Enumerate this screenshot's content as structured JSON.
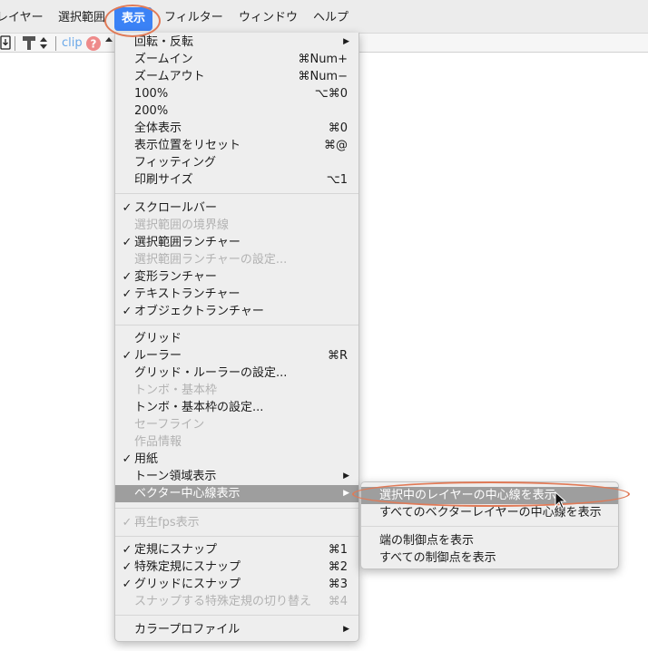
{
  "menubar": {
    "items": [
      "レイヤー",
      "選択範囲",
      "表示",
      "フィルター",
      "ウィンドウ",
      "ヘルプ"
    ]
  },
  "toolbar": {
    "clip_label": "clip",
    "help_symbol": "?"
  },
  "view_menu": {
    "items": [
      {
        "label": "回転・反転",
        "submenu": true
      },
      {
        "label": "ズームイン",
        "shortcut": "⌘Num+"
      },
      {
        "label": "ズームアウト",
        "shortcut": "⌘Num−"
      },
      {
        "label": "100%",
        "shortcut": "⌥⌘0"
      },
      {
        "label": "200%",
        "shortcut": ""
      },
      {
        "label": "全体表示",
        "shortcut": "⌘0"
      },
      {
        "label": "表示位置をリセット",
        "shortcut": "⌘@"
      },
      {
        "label": "フィッティング",
        "shortcut": ""
      },
      {
        "label": "印刷サイズ",
        "shortcut": "⌥1"
      },
      {
        "label": "スクロールバー",
        "checked": true
      },
      {
        "label": "選択範囲の境界線",
        "disabled": true
      },
      {
        "label": "選択範囲ランチャー",
        "checked": true
      },
      {
        "label": "選択範囲ランチャーの設定...",
        "disabled": true
      },
      {
        "label": "変形ランチャー",
        "checked": true
      },
      {
        "label": "テキストランチャー",
        "checked": true
      },
      {
        "label": "オブジェクトランチャー",
        "checked": true
      },
      {
        "label": "グリッド"
      },
      {
        "label": "ルーラー",
        "checked": true,
        "shortcut": "⌘R"
      },
      {
        "label": "グリッド・ルーラーの設定..."
      },
      {
        "label": "トンボ・基本枠",
        "disabled": true
      },
      {
        "label": "トンボ・基本枠の設定..."
      },
      {
        "label": "セーフライン",
        "disabled": true
      },
      {
        "label": "作品情報",
        "disabled": true
      },
      {
        "label": "用紙",
        "checked": true
      },
      {
        "label": "トーン領域表示",
        "submenu": true
      },
      {
        "label": "ベクター中心線表示",
        "submenu": true,
        "highlighted": true
      },
      {
        "label": "再生fps表示",
        "checked": true,
        "disabled": true
      },
      {
        "label": "定規にスナップ",
        "checked": true,
        "shortcut": "⌘1"
      },
      {
        "label": "特殊定規にスナップ",
        "checked": true,
        "shortcut": "⌘2"
      },
      {
        "label": "グリッドにスナップ",
        "checked": true,
        "shortcut": "⌘3"
      },
      {
        "label": "スナップする特殊定規の切り替え",
        "disabled": true,
        "shortcut": "⌘4"
      },
      {
        "label": "カラープロファイル",
        "submenu": true
      }
    ]
  },
  "vector_submenu": {
    "items": [
      {
        "label": "選択中のレイヤーの中心線を表示",
        "highlighted": true
      },
      {
        "label": "すべてのベクターレイヤーの中心線を表示"
      },
      {
        "label": "端の制御点を表示"
      },
      {
        "label": "すべての制御点を表示"
      }
    ]
  },
  "symbols": {
    "check": "✓",
    "arrow": "▶"
  },
  "colors": {
    "highlight": "#9e9e9e",
    "menubar_active": "#3b82f6",
    "annotation": "#e07a57"
  }
}
